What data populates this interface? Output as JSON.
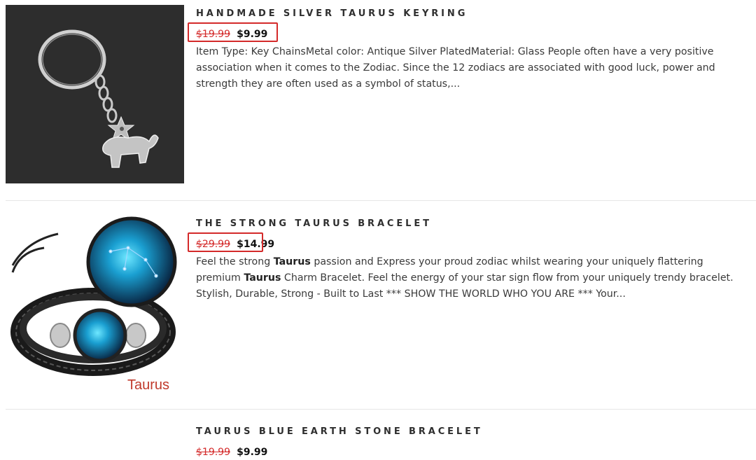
{
  "products": [
    {
      "title": "HANDMADE SILVER TAURUS KEYRING",
      "old_price": "$19.99",
      "new_price": "$9.99",
      "description": "Item Type: Key ChainsMetal color: Antique Silver PlatedMaterial: Glass People often have a very positive association when it comes to the Zodiac. Since the 12 zodiacs are associated with good luck, power and strength they are often used as a symbol of status,...",
      "image": "taurus-keyring-photo"
    },
    {
      "title": "THE STRONG TAURUS BRACELET",
      "old_price": "$29.99",
      "new_price": "$14.99",
      "description_parts": [
        "Feel the strong ",
        "Taurus",
        " passion and Express your proud zodiac whilst wearing your uniquely flattering premium ",
        "Taurus",
        " Charm Bracelet. Feel the energy of your star sign flow from your uniquely trendy bracelet. Stylish, Durable, Strong - Built to Last *** SHOW THE WORLD WHO YOU ARE *** Your..."
      ],
      "image_label": "Taurus",
      "image": "taurus-bracelet-photo"
    },
    {
      "title": "TAURUS BLUE EARTH STONE BRACELET",
      "old_price": "$19.99",
      "new_price": "$9.99"
    }
  ],
  "colors": {
    "highlight": "#d42a2a",
    "sale_old": "#d42a2a"
  }
}
